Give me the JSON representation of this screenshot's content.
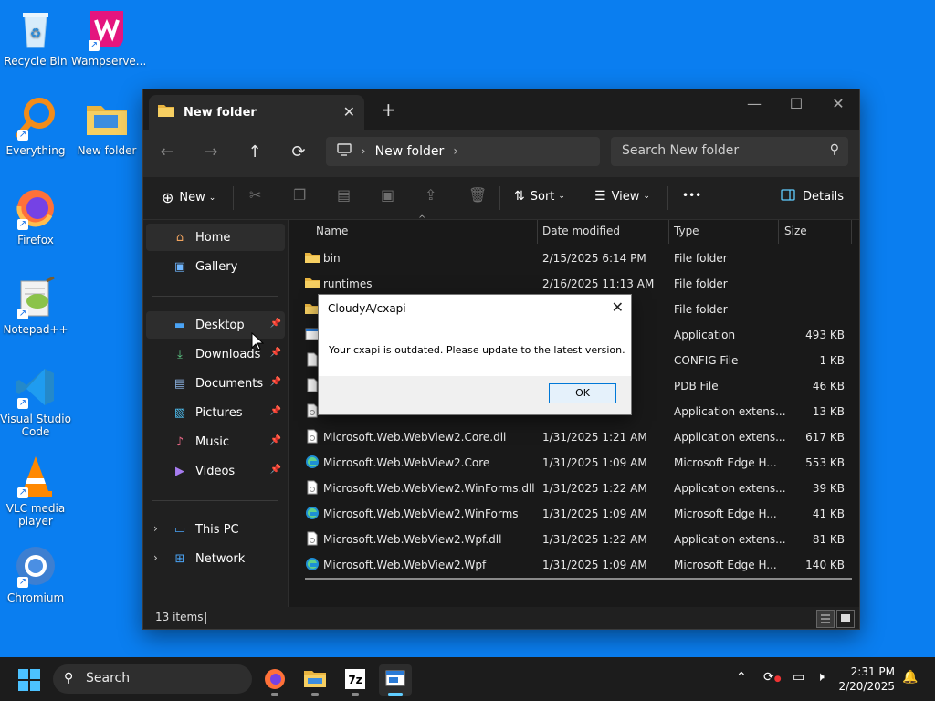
{
  "desktop": {
    "icons": [
      {
        "label": "Recycle Bin"
      },
      {
        "label": "Wampserve..."
      },
      {
        "label": "Everything"
      },
      {
        "label": "New folder"
      },
      {
        "label": "Firefox"
      },
      {
        "label": "Notepad++"
      },
      {
        "label": "Visual Studio Code"
      },
      {
        "label": "VLC media player"
      },
      {
        "label": "Chromium"
      }
    ]
  },
  "explorer": {
    "tab_title": "New folder",
    "new_tab_glyph": "+",
    "address_crumb": "New folder",
    "search_placeholder": "Search New folder",
    "toolbar": {
      "new_label": "New",
      "sort_label": "Sort",
      "view_label": "View",
      "more_label": "•••",
      "details_label": "Details"
    },
    "sidebar": {
      "items": [
        {
          "label": "Home",
          "icon": "home-icon"
        },
        {
          "label": "Gallery",
          "icon": "gallery-icon"
        },
        {
          "label": "Desktop",
          "icon": "desktop-icon"
        },
        {
          "label": "Downloads",
          "icon": "downloads-icon"
        },
        {
          "label": "Documents",
          "icon": "documents-icon"
        },
        {
          "label": "Pictures",
          "icon": "pictures-icon"
        },
        {
          "label": "Music",
          "icon": "music-icon"
        },
        {
          "label": "Videos",
          "icon": "videos-icon"
        },
        {
          "label": "This PC",
          "icon": "this-pc-icon"
        },
        {
          "label": "Network",
          "icon": "network-icon"
        }
      ]
    },
    "columns": [
      "Name",
      "Date modified",
      "Type",
      "Size"
    ],
    "files": [
      {
        "name": "bin",
        "date": "2/15/2025 6:14 PM",
        "type": "File folder",
        "size": "",
        "icon": "folder"
      },
      {
        "name": "runtimes",
        "date": "2/16/2025 11:13 AM",
        "type": "File folder",
        "size": "",
        "icon": "folder"
      },
      {
        "name": "",
        "date": "",
        "type": "File folder",
        "size": "",
        "icon": "folder"
      },
      {
        "name": "",
        "date": "",
        "type": "Application",
        "size": "493 KB",
        "icon": "app"
      },
      {
        "name": "",
        "date": "",
        "type": "CONFIG File",
        "size": "1 KB",
        "icon": "doc"
      },
      {
        "name": "",
        "date": "",
        "type": "PDB File",
        "size": "46 KB",
        "icon": "doc"
      },
      {
        "name": "",
        "date": "",
        "type": "Application extens...",
        "size": "13 KB",
        "icon": "dll"
      },
      {
        "name": "Microsoft.Web.WebView2.Core.dll",
        "date": "1/31/2025 1:21 AM",
        "type": "Application extens...",
        "size": "617 KB",
        "icon": "dll"
      },
      {
        "name": "Microsoft.Web.WebView2.Core",
        "date": "1/31/2025 1:09 AM",
        "type": "Microsoft Edge H...",
        "size": "553 KB",
        "icon": "edge"
      },
      {
        "name": "Microsoft.Web.WebView2.WinForms.dll",
        "date": "1/31/2025 1:22 AM",
        "type": "Application extens...",
        "size": "39 KB",
        "icon": "dll"
      },
      {
        "name": "Microsoft.Web.WebView2.WinForms",
        "date": "1/31/2025 1:09 AM",
        "type": "Microsoft Edge H...",
        "size": "41 KB",
        "icon": "edge"
      },
      {
        "name": "Microsoft.Web.WebView2.Wpf.dll",
        "date": "1/31/2025 1:22 AM",
        "type": "Application extens...",
        "size": "81 KB",
        "icon": "dll"
      },
      {
        "name": "Microsoft.Web.WebView2.Wpf",
        "date": "1/31/2025 1:09 AM",
        "type": "Microsoft Edge H...",
        "size": "140 KB",
        "icon": "edge"
      }
    ],
    "status_count": "13 items"
  },
  "dialog": {
    "title": "CloudyA/cxapi",
    "message": "Your cxapi is outdated. Please update to the latest version.",
    "ok_label": "OK"
  },
  "taskbar": {
    "search_label": "Search",
    "time": "2:31 PM",
    "date": "2/20/2025",
    "apps": [
      "firefox-icon",
      "file-explorer-icon",
      "7zip-icon",
      "app-window-icon"
    ]
  },
  "colors": {
    "desktop": "#0a7ef0",
    "accent": "#60cdff",
    "folder": "#f2c55c"
  }
}
